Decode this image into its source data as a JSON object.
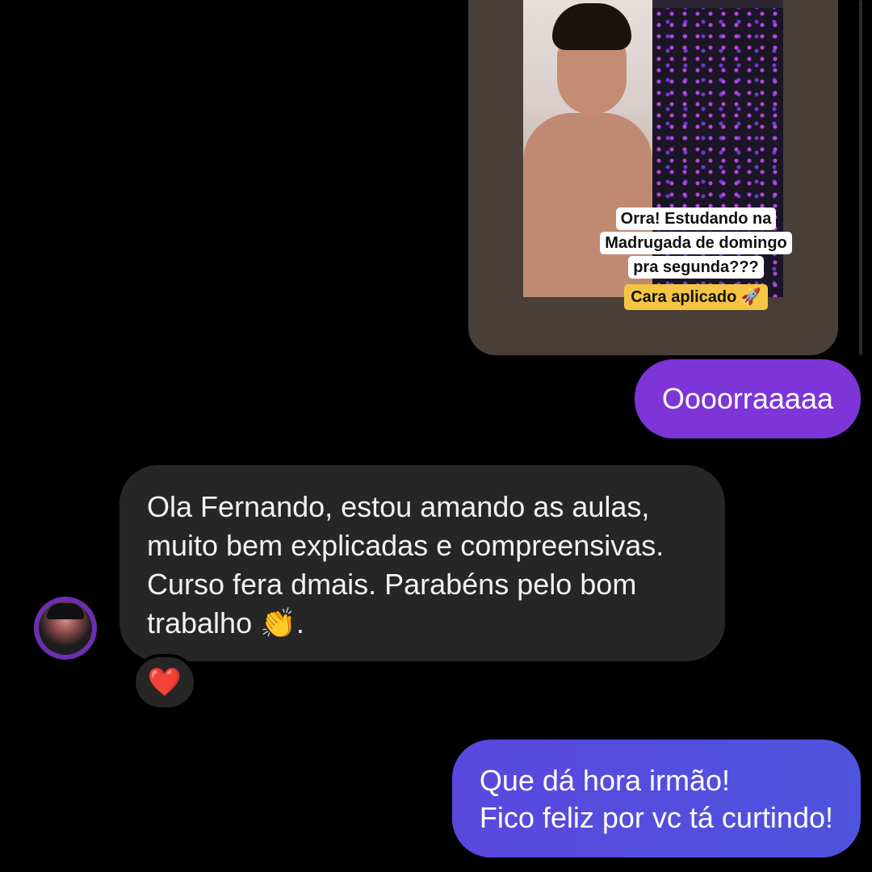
{
  "shared_story": {
    "caption_lines": [
      "Orra! Estudando na",
      "Madrugada de domingo",
      "pra segunda???"
    ],
    "caption_highlight": "Cara aplicado 🚀"
  },
  "messages": {
    "outgoing_1": "Oooorraaaaa",
    "incoming_1": {
      "lines": [
        "Ola Fernando, estou amando as aulas,",
        "muito bem explicadas e compreensivas.",
        "Curso fera dmais. Parabéns pelo bom",
        "trabalho 👏."
      ],
      "reaction": "❤️"
    },
    "outgoing_2": {
      "lines": [
        "Que dá hora irmão!",
        "Fico feliz por vc tá curtindo!"
      ]
    }
  },
  "colors": {
    "outgoing_primary": "#7d35d8",
    "outgoing_secondary": "#5a48de",
    "incoming_bubble": "#262626",
    "background": "#000000"
  }
}
